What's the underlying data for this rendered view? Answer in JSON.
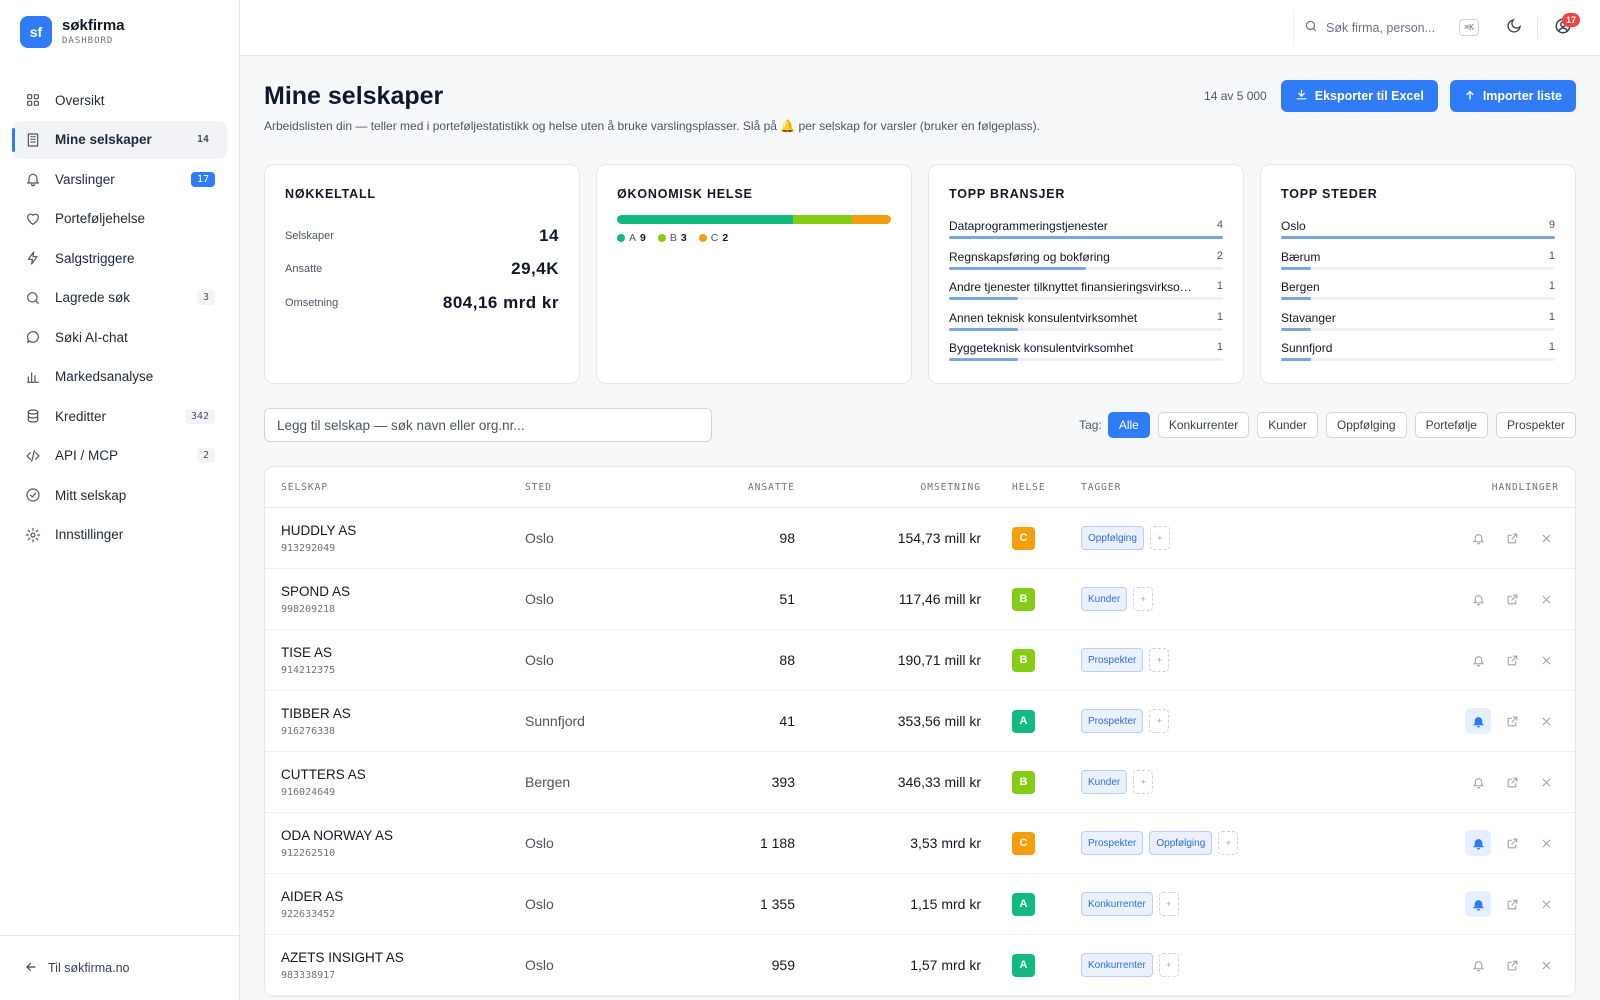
{
  "brand": {
    "logo": "sf",
    "name": "søkfirma",
    "sub": "DASHBORD"
  },
  "nav": [
    {
      "key": "oversikt",
      "label": "Oversikt",
      "icon": "grid-icon",
      "badge": ""
    },
    {
      "key": "mine-selskaper",
      "label": "Mine selskaper",
      "icon": "building-icon",
      "badge": "14",
      "active": true
    },
    {
      "key": "varslinger",
      "label": "Varslinger",
      "icon": "bell-icon",
      "badge": "17",
      "badgeBlue": true
    },
    {
      "key": "portefoljehelse",
      "label": "Porteføljehelse",
      "icon": "heart-icon",
      "badge": ""
    },
    {
      "key": "salgstriggere",
      "label": "Salgstriggere",
      "icon": "bolt-icon",
      "badge": ""
    },
    {
      "key": "lagrede-sok",
      "label": "Lagrede søk",
      "icon": "search-icon",
      "badge": "3"
    },
    {
      "key": "soki-ai-chat",
      "label": "Søki AI-chat",
      "icon": "chat-icon",
      "badge": ""
    },
    {
      "key": "markedsanalyse",
      "label": "Markedsanalyse",
      "icon": "bar-chart-icon",
      "badge": ""
    },
    {
      "key": "kreditter",
      "label": "Kreditter",
      "icon": "database-icon",
      "badge": "342"
    },
    {
      "key": "api-mcp",
      "label": "API / MCP",
      "icon": "code-icon",
      "badge": "2"
    },
    {
      "key": "mitt-selskap",
      "label": "Mitt selskap",
      "icon": "check-circle-icon",
      "badge": ""
    },
    {
      "key": "innstillinger",
      "label": "Innstillinger",
      "icon": "gear-icon",
      "badge": ""
    }
  ],
  "footer_link": "Til søkfirma.no",
  "topbar": {
    "search_placeholder": "Søk firma, person...",
    "kbd": "⌘K",
    "notif_count": "17"
  },
  "page": {
    "title": "Mine selskaper",
    "subtitle": "Arbeidslisten din — teller med i porteføljestatistikk og helse uten å bruke varslingsplasser. Slå på 🔔 per selskap for varsler (bruker en følgeplass).",
    "count": "14 av 5 000",
    "export_label": "Eksporter til Excel",
    "import_label": "Importer liste"
  },
  "cards": {
    "kpi": {
      "title": "NØKKELTALL",
      "items": [
        {
          "label": "Selskaper",
          "value": "14"
        },
        {
          "label": "Ansatte",
          "value": "29,4K"
        },
        {
          "label": "Omsetning",
          "value": "804,16 mrd kr"
        }
      ]
    },
    "health": {
      "title": "ØKONOMISK HELSE",
      "segments": [
        {
          "grade": "A",
          "count": 9,
          "color": "#12b981"
        },
        {
          "grade": "B",
          "count": 3,
          "color": "#84cc16"
        },
        {
          "grade": "C",
          "count": 2,
          "color": "#f59e0b"
        }
      ]
    },
    "bransjer": {
      "title": "TOPP BRANSJER",
      "items": [
        {
          "name": "Dataprogrammeringstjenester",
          "count": 4
        },
        {
          "name": "Regnskapsføring og bokføring",
          "count": 2
        },
        {
          "name": "Andre tjenester tilknyttet finansieringsvirksomhet",
          "count": 1
        },
        {
          "name": "Annen teknisk konsulentvirksomhet",
          "count": 1
        },
        {
          "name": "Byggeteknisk konsulentvirksomhet",
          "count": 1
        }
      ]
    },
    "steder": {
      "title": "TOPP STEDER",
      "items": [
        {
          "name": "Oslo",
          "count": 9
        },
        {
          "name": "Bærum",
          "count": 1
        },
        {
          "name": "Bergen",
          "count": 1
        },
        {
          "name": "Stavanger",
          "count": 1
        },
        {
          "name": "Sunnfjord",
          "count": 1
        }
      ]
    }
  },
  "add_placeholder": "Legg til selskap — søk navn eller org.nr...",
  "tag_filter": {
    "label": "Tag:",
    "options": [
      "Alle",
      "Konkurrenter",
      "Kunder",
      "Oppfølging",
      "Portefølje",
      "Prospekter"
    ],
    "active": "Alle"
  },
  "table": {
    "headers": {
      "name": "SELSKAP",
      "sted": "STED",
      "ansatte": "ANSATTE",
      "omsetning": "OMSETNING",
      "helse": "HELSE",
      "tagger": "TAGGER",
      "handlinger": "HANDLINGER"
    },
    "rows": [
      {
        "name": "HUDDLY AS",
        "org": "913292049",
        "sted": "Oslo",
        "ansatte": "98",
        "omsetning": "154,73 mill kr",
        "helse": "C",
        "tags": [
          "Oppfølging"
        ],
        "bell": false
      },
      {
        "name": "SPOND AS",
        "org": "998209218",
        "sted": "Oslo",
        "ansatte": "51",
        "omsetning": "117,46 mill kr",
        "helse": "B",
        "tags": [
          "Kunder"
        ],
        "bell": false
      },
      {
        "name": "TISE AS",
        "org": "914212375",
        "sted": "Oslo",
        "ansatte": "88",
        "omsetning": "190,71 mill kr",
        "helse": "B",
        "tags": [
          "Prospekter"
        ],
        "bell": false
      },
      {
        "name": "TIBBER AS",
        "org": "916276338",
        "sted": "Sunnfjord",
        "ansatte": "41",
        "omsetning": "353,56 mill kr",
        "helse": "A",
        "tags": [
          "Prospekter"
        ],
        "bell": true
      },
      {
        "name": "CUTTERS AS",
        "org": "916024649",
        "sted": "Bergen",
        "ansatte": "393",
        "omsetning": "346,33 mill kr",
        "helse": "B",
        "tags": [
          "Kunder"
        ],
        "bell": false
      },
      {
        "name": "ODA NORWAY AS",
        "org": "912262510",
        "sted": "Oslo",
        "ansatte": "1 188",
        "omsetning": "3,53 mrd kr",
        "helse": "C",
        "tags": [
          "Prospekter",
          "Oppfølging"
        ],
        "bell": true
      },
      {
        "name": "AIDER AS",
        "org": "922633452",
        "sted": "Oslo",
        "ansatte": "1 355",
        "omsetning": "1,15 mrd kr",
        "helse": "A",
        "tags": [
          "Konkurrenter"
        ],
        "bell": true
      },
      {
        "name": "AZETS INSIGHT AS",
        "org": "983338917",
        "sted": "Oslo",
        "ansatte": "959",
        "omsetning": "1,57 mrd kr",
        "helse": "A",
        "tags": [
          "Konkurrenter"
        ],
        "bell": false
      }
    ]
  },
  "colors": {
    "accent": "#2f7cf6",
    "gradeA": "#12b981",
    "gradeB": "#84cc16",
    "gradeC": "#f59e0b"
  }
}
